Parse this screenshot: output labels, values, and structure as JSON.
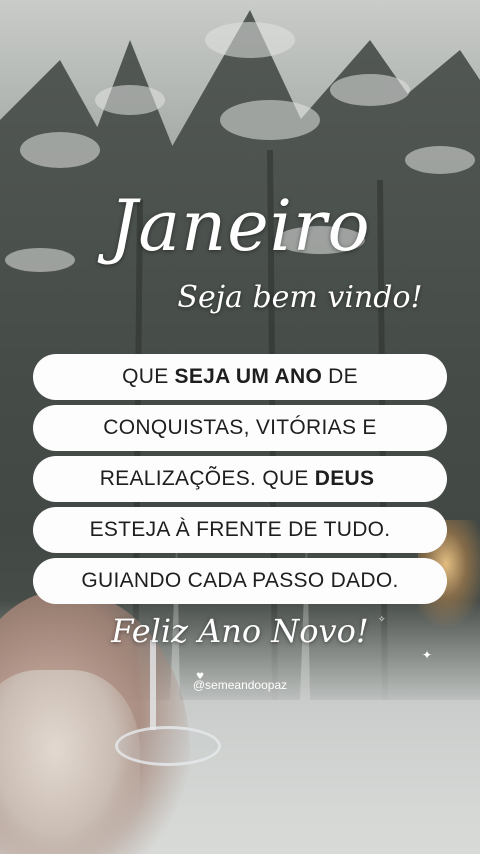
{
  "title": "Janeiro",
  "subtitle": "Seja bem vindo!",
  "message_lines": [
    {
      "pre": "QUE",
      "bold": "SEJA UM ANO",
      "post": "DE"
    },
    {
      "pre": "CONQUISTAS, VITÓRIAS E",
      "bold": "",
      "post": ""
    },
    {
      "pre": "REALIZAÇÕES. QUE",
      "bold": "DEUS",
      "post": ""
    },
    {
      "pre": "ESTEJA À FRENTE DE TUDO.",
      "bold": "",
      "post": ""
    },
    {
      "pre": "GUIANDO CADA PASSO DADO.",
      "bold": "",
      "post": ""
    }
  ],
  "closing": "Feliz Ano Novo!",
  "handle": "@semeandoopaz",
  "colors": {
    "pill_bg": "#fdfdfd",
    "text_dark": "#1e1e1e",
    "script_text": "#ffffff"
  }
}
